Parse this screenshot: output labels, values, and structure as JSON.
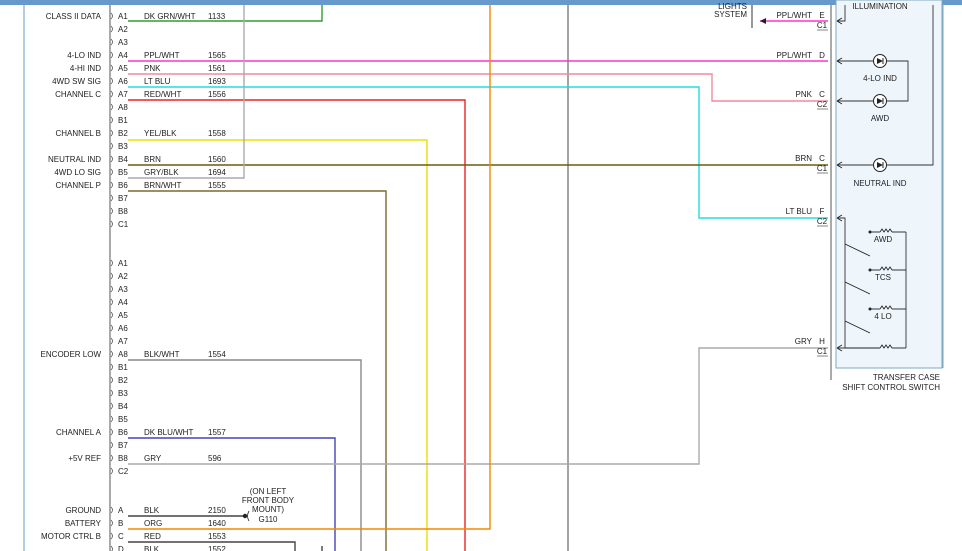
{
  "module_pins": [
    {
      "label": "CLASS II DATA",
      "pin": "A1",
      "wire": "DK GRN/WHT",
      "circuit": "1133"
    },
    {
      "label": "",
      "pin": "A2",
      "wire": "",
      "circuit": ""
    },
    {
      "label": "",
      "pin": "A3",
      "wire": "",
      "circuit": ""
    },
    {
      "label": "4-LO IND",
      "pin": "A4",
      "wire": "PPL/WHT",
      "circuit": "1565"
    },
    {
      "label": "4-HI IND",
      "pin": "A5",
      "wire": "PNK",
      "circuit": "1561"
    },
    {
      "label": "4WD SW SIG",
      "pin": "A6",
      "wire": "LT BLU",
      "circuit": "1693"
    },
    {
      "label": "CHANNEL C",
      "pin": "A7",
      "wire": "RED/WHT",
      "circuit": "1556"
    },
    {
      "label": "",
      "pin": "A8",
      "wire": "",
      "circuit": ""
    },
    {
      "label": "",
      "pin": "B1",
      "wire": "",
      "circuit": ""
    },
    {
      "label": "CHANNEL B",
      "pin": "B2",
      "wire": "YEL/BLK",
      "circuit": "1558"
    },
    {
      "label": "",
      "pin": "B3",
      "wire": "",
      "circuit": ""
    },
    {
      "label": "NEUTRAL IND",
      "pin": "B4",
      "wire": "BRN",
      "circuit": "1560"
    },
    {
      "label": "4WD LO SIG",
      "pin": "B5",
      "wire": "GRY/BLK",
      "circuit": "1694"
    },
    {
      "label": "CHANNEL P",
      "pin": "B6",
      "wire": "BRN/WHT",
      "circuit": "1555"
    },
    {
      "label": "",
      "pin": "B7",
      "wire": "",
      "circuit": ""
    },
    {
      "label": "",
      "pin": "B8",
      "wire": "",
      "circuit": ""
    },
    {
      "label": "",
      "pin": "C1",
      "wire": "",
      "circuit": ""
    },
    {
      "label": "",
      "pin": "A1",
      "wire": "",
      "circuit": ""
    },
    {
      "label": "",
      "pin": "A2",
      "wire": "",
      "circuit": ""
    },
    {
      "label": "",
      "pin": "A3",
      "wire": "",
      "circuit": ""
    },
    {
      "label": "",
      "pin": "A4",
      "wire": "",
      "circuit": ""
    },
    {
      "label": "",
      "pin": "A5",
      "wire": "",
      "circuit": ""
    },
    {
      "label": "",
      "pin": "A6",
      "wire": "",
      "circuit": ""
    },
    {
      "label": "",
      "pin": "A7",
      "wire": "",
      "circuit": ""
    },
    {
      "label": "ENCODER LOW",
      "pin": "A8",
      "wire": "BLK/WHT",
      "circuit": "1554"
    },
    {
      "label": "",
      "pin": "B1",
      "wire": "",
      "circuit": ""
    },
    {
      "label": "",
      "pin": "B2",
      "wire": "",
      "circuit": ""
    },
    {
      "label": "",
      "pin": "B3",
      "wire": "",
      "circuit": ""
    },
    {
      "label": "",
      "pin": "B4",
      "wire": "",
      "circuit": ""
    },
    {
      "label": "",
      "pin": "B5",
      "wire": "",
      "circuit": ""
    },
    {
      "label": "CHANNEL A",
      "pin": "B6",
      "wire": "DK BLU/WHT",
      "circuit": "1557"
    },
    {
      "label": "",
      "pin": "B7",
      "wire": "",
      "circuit": ""
    },
    {
      "label": "+5V REF",
      "pin": "B8",
      "wire": "GRY",
      "circuit": "596"
    },
    {
      "label": "",
      "pin": "C2",
      "wire": "",
      "circuit": ""
    },
    {
      "label": "GROUND",
      "pin": "A",
      "wire": "BLK",
      "circuit": "2150"
    },
    {
      "label": "BATTERY",
      "pin": "B",
      "wire": "ORG",
      "circuit": "1640"
    },
    {
      "label": "MOTOR CTRL B",
      "pin": "C",
      "wire": "RED",
      "circuit": "1553"
    },
    {
      "label": "",
      "pin": "D",
      "wire": "BLK",
      "circuit": "1552"
    }
  ],
  "switch_pins": [
    {
      "wire": "PPL/WHT",
      "pin": "E",
      "connector": "C1"
    },
    {
      "wire": "PPL/WHT",
      "pin": "D",
      "connector": ""
    },
    {
      "wire": "PNK",
      "pin": "C",
      "connector": "C2"
    },
    {
      "wire": "BRN",
      "pin": "C",
      "connector": "C1"
    },
    {
      "wire": "LT BLU",
      "pin": "F",
      "connector": "C2"
    },
    {
      "wire": "GRY",
      "pin": "H",
      "connector": "C1"
    }
  ],
  "indicators": {
    "lo_ind": "4-LO IND",
    "awd": "AWD",
    "neutral_ind": "NEUTRAL IND"
  },
  "switch_positions": [
    "AWD",
    "TCS",
    "4 LO"
  ],
  "switch_title": [
    "TRANSFER CASE",
    "SHIFT CONTROL SWITCH"
  ],
  "illumination_label": "ILLUMINATION",
  "lights_label": [
    "LIGHTS",
    "SYSTEM"
  ],
  "ground_note": [
    "(ON LEFT",
    "FRONT BODY",
    "MOUNT)",
    "G110"
  ],
  "colors": {
    "dk_grn_wht": "#2ea02e",
    "ppl_wht": "#ff33cc",
    "pnk": "#ff66cc",
    "pnk_light": "#f28aa0",
    "lt_blu": "#22dddd",
    "red": "#ee2222",
    "yel": "#e8e000",
    "brn": "#6b5a10",
    "gry": "#aaaaaa",
    "brn_wht": "#7a6a30",
    "dk_blu": "#4444bb",
    "org": "#f08800",
    "blk": "#555555",
    "panel_fill": "#eef6fb",
    "panel_stroke": "#7fa8c0",
    "frame": "#6699cc"
  }
}
